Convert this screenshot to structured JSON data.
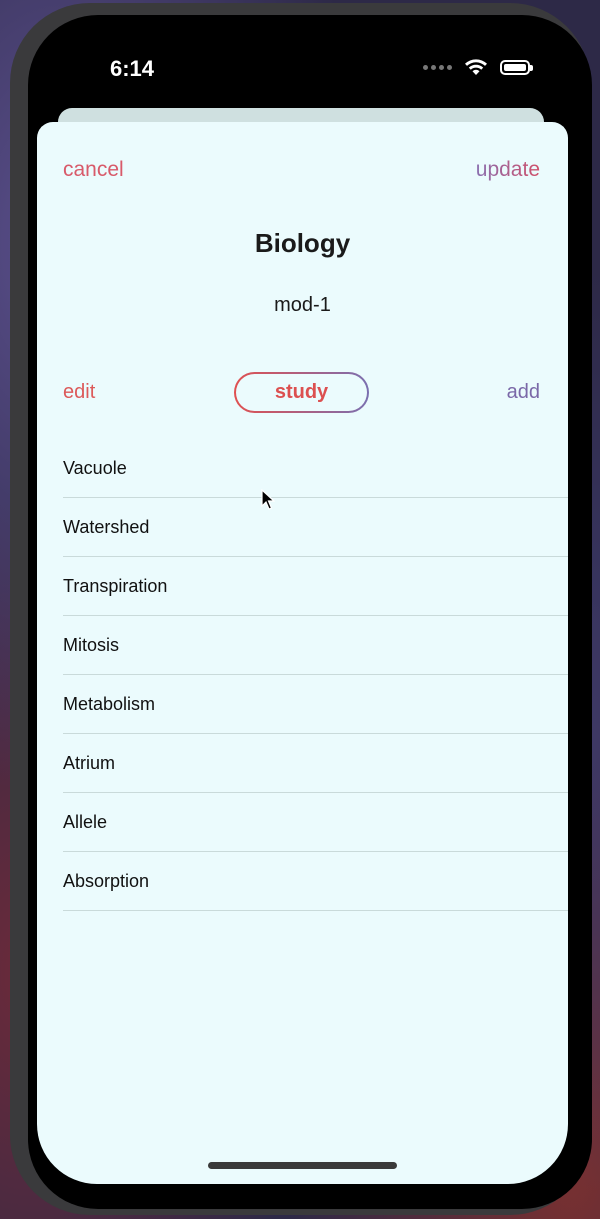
{
  "status_bar": {
    "time": "6:14"
  },
  "nav": {
    "cancel_label": "cancel",
    "update_label": "update"
  },
  "deck": {
    "title": "Biology",
    "subtitle": "mod-1"
  },
  "tabs": {
    "edit_label": "edit",
    "study_label": "study",
    "add_label": "add",
    "selected": "study"
  },
  "terms": [
    {
      "label": "Vacuole"
    },
    {
      "label": "Watershed"
    },
    {
      "label": "Transpiration"
    },
    {
      "label": "Mitosis"
    },
    {
      "label": "Metabolism"
    },
    {
      "label": "Atrium"
    },
    {
      "label": "Allele"
    },
    {
      "label": "Absorption"
    }
  ],
  "colors": {
    "sheet_background": "#ebfbfd",
    "accent_red": "#dc5050",
    "accent_purple": "#7a68a8"
  }
}
